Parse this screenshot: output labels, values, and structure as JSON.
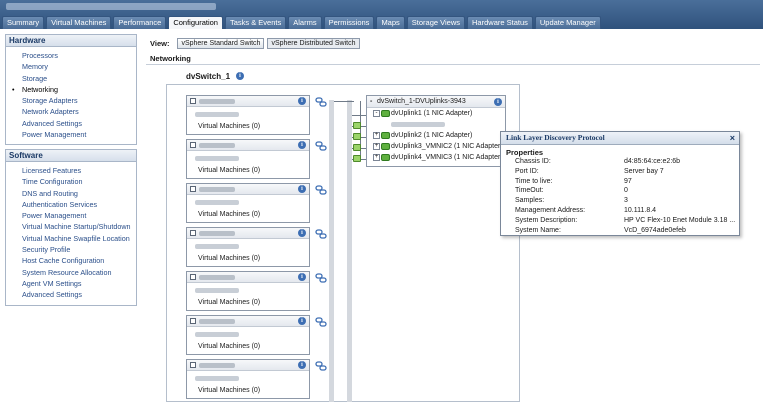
{
  "tabs": [
    "Summary",
    "Virtual Machines",
    "Performance",
    "Configuration",
    "Tasks & Events",
    "Alarms",
    "Permissions",
    "Maps",
    "Storage Views",
    "Hardware Status",
    "Update Manager"
  ],
  "active_tab": "Configuration",
  "hardware": {
    "title": "Hardware",
    "items": [
      "Processors",
      "Memory",
      "Storage",
      "Networking",
      "Storage Adapters",
      "Network Adapters",
      "Advanced Settings",
      "Power Management"
    ],
    "current": "Networking"
  },
  "software": {
    "title": "Software",
    "items": [
      "Licensed Features",
      "Time Configuration",
      "DNS and Routing",
      "Authentication Services",
      "Power Management",
      "Virtual Machine Startup/Shutdown",
      "Virtual Machine Swapfile Location",
      "Security Profile",
      "Host Cache Configuration",
      "System Resource Allocation",
      "Agent VM Settings",
      "Advanced Settings"
    ]
  },
  "view": {
    "label": "View:",
    "standard": "vSphere Standard Switch",
    "distributed": "vSphere Distributed Switch"
  },
  "section_title": "Networking",
  "switch_name": "dvSwitch_1",
  "port_groups": [
    {
      "vm": "Virtual Machines (0)"
    },
    {
      "vm": "Virtual Machines (0)"
    },
    {
      "vm": "Virtual Machines (0)"
    },
    {
      "vm": "Virtual Machines (0)"
    },
    {
      "vm": "Virtual Machines (0)"
    },
    {
      "vm": "Virtual Machines (0)"
    },
    {
      "vm": "Virtual Machines (0)"
    }
  ],
  "uplinks": {
    "title": "dvSwitch_1-DVUplinks-3943",
    "items": [
      "dvUplink1 (1 NIC Adapter)",
      "dvUplink2 (1 NIC Adapter)",
      "dvUplink3_VMNIC2 (1 NIC Adapter)",
      "dvUplink4_VMNIC3 (1 NIC Adapter)"
    ]
  },
  "lldp": {
    "title": "Link Layer Discovery Protocol",
    "close": "×",
    "properties_label": "Properties",
    "rows": [
      {
        "key": "Chassis ID:",
        "value": "d4:85:64:ce:e2:6b"
      },
      {
        "key": "Port ID:",
        "value": "Server bay 7"
      },
      {
        "key": "Time to live:",
        "value": "97"
      },
      {
        "key": "TimeOut:",
        "value": "0"
      },
      {
        "key": "Samples:",
        "value": "3"
      },
      {
        "key": "Management Address:",
        "value": "10.111.8.4"
      },
      {
        "key": "System Description:",
        "value": "HP VC Flex-10 Enet Module 3.18 ..."
      },
      {
        "key": "System Name:",
        "value": "VcD_6974ade0efeb"
      }
    ]
  },
  "icons": {
    "info": "info-icon",
    "chain": "link-chain-icon",
    "nic": "nic-adapter-icon",
    "close": "close-icon"
  },
  "colors": {
    "title_bar": "#2f527c",
    "link_text": "#2b4f8a",
    "nic_green": "#5fb03f"
  }
}
